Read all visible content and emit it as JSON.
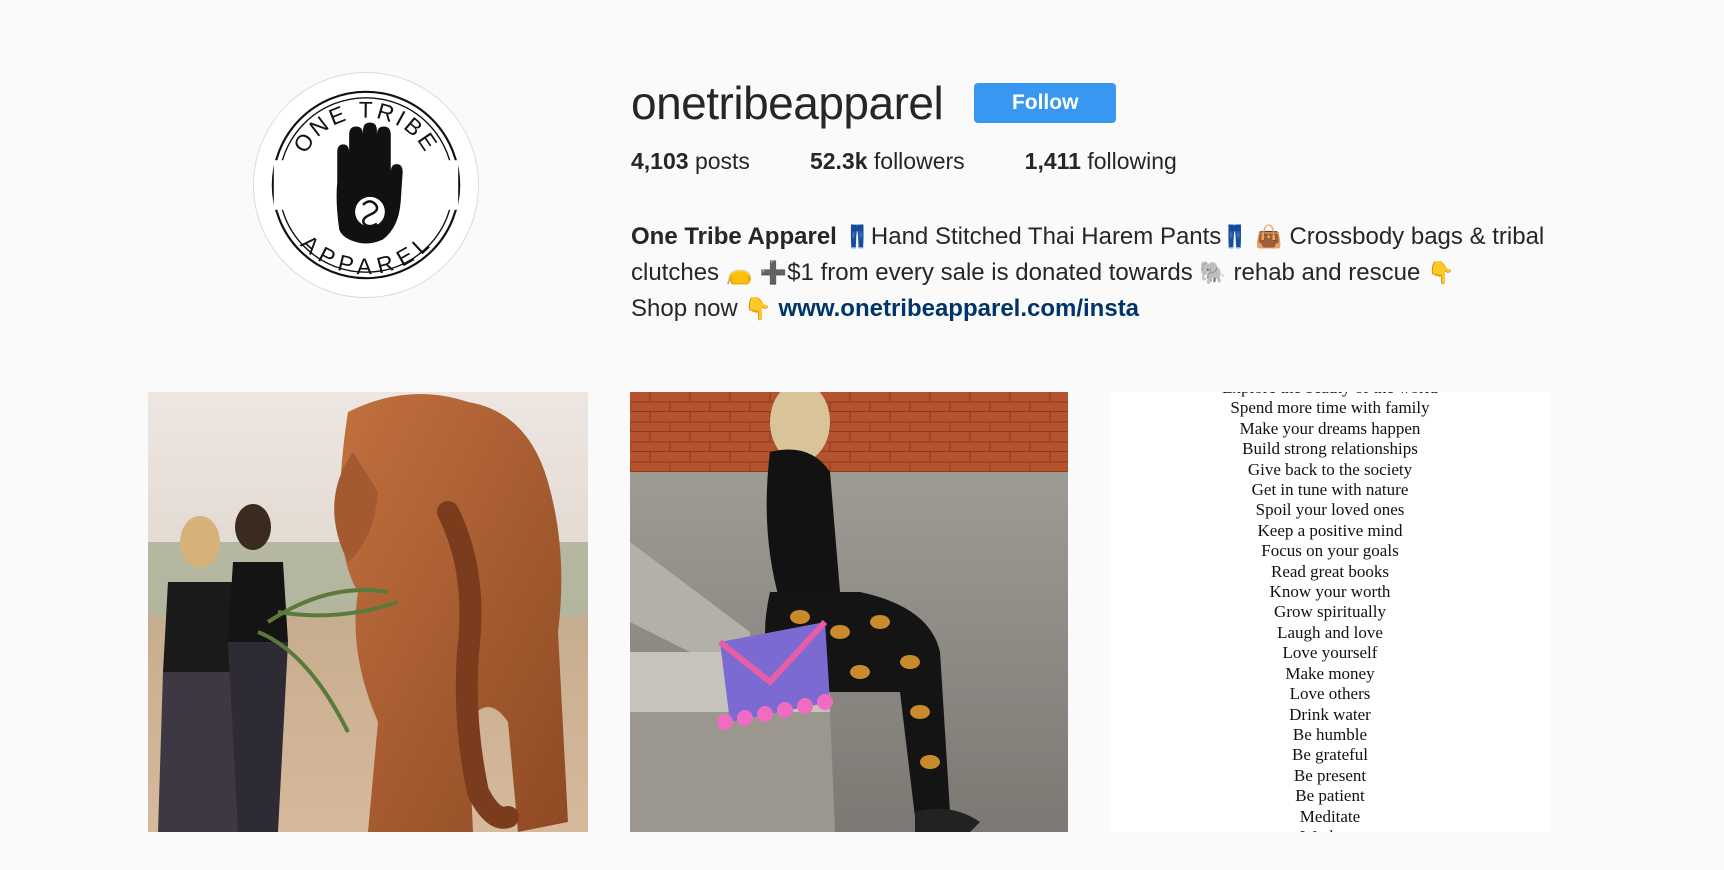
{
  "profile": {
    "username": "onetribeapparel",
    "follow_label": "Follow",
    "avatar": {
      "top_text": "ONE TRIBE",
      "bottom_text": "APPAREL",
      "icon": "hamsa-hand-icon"
    }
  },
  "stats": {
    "posts_count": "4,103",
    "posts_label": "posts",
    "followers_count": "52.3k",
    "followers_label": "followers",
    "following_count": "1,411",
    "following_label": "following"
  },
  "bio": {
    "name": "One Tribe Apparel",
    "emoji_pants": "👖",
    "text_1": "Hand Stitched Thai Harem Pants",
    "emoji_handbag": "👜",
    "text_2": "Crossbody bags & tribal clutches",
    "emoji_clutch": "👝",
    "emoji_plus": "➕",
    "text_3": "$1 from every sale is donated towards",
    "emoji_elephant": "🐘",
    "text_4": "rehab and rescue",
    "emoji_point_down": "👇",
    "text_5": "Shop now",
    "link": "www.onetribeapparel.com/insta"
  },
  "posts": [
    {
      "subject": "women-feeding-elephant-photo"
    },
    {
      "subject": "woman-sitting-elephant-pants-photo"
    },
    {
      "subject": "text-list-image",
      "lines": [
        "Explore the beauty of the world",
        "Spend more time with family",
        "Make your dreams happen",
        "Build strong relationships",
        "Give back to the society",
        "Get in tune with nature",
        "Spoil your loved ones",
        "Keep a positive mind",
        "Focus on your goals",
        "Read great books",
        "Know your worth",
        "Grow spiritually",
        "Laugh and love",
        "Love yourself",
        "Make money",
        "Love others",
        "Drink water",
        "Be humble",
        "Be grateful",
        "Be present",
        "Be patient",
        "Meditate",
        "Workout"
      ]
    }
  ],
  "colors": {
    "background": "#fafafa",
    "follow_button": "#3897f0",
    "link": "#003569",
    "text": "#262626"
  }
}
